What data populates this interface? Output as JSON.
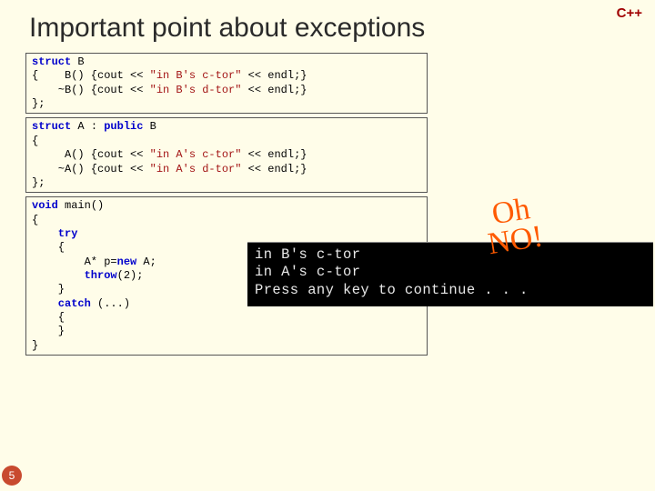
{
  "badge": "C++",
  "title": "Important point about exceptions",
  "code": {
    "b1_l1a": "struct",
    "b1_l1b": " B",
    "b1_l2a": "{    B() {cout << ",
    "b1_l2b": "\"in B's c-tor\"",
    "b1_l2c": " << endl;}",
    "b1_l3a": "    ~B() {cout << ",
    "b1_l3b": "\"in B's d-tor\"",
    "b1_l3c": " << endl;}",
    "b1_l4": "};",
    "b2_l1a": "struct",
    "b2_l1b": " A : ",
    "b2_l1c": "public",
    "b2_l1d": " B",
    "b2_l2": "{",
    "b2_l3a": "     A() {cout << ",
    "b2_l3b": "\"in A's c-tor\"",
    "b2_l3c": " << endl;}",
    "b2_l4a": "    ~A() {cout << ",
    "b2_l4b": "\"in A's d-tor\"",
    "b2_l4c": " << endl;}",
    "b2_l5": "};",
    "b3_l1a": "void",
    "b3_l1b": " main()",
    "b3_l2": "{",
    "b3_l3a": "    try",
    "b3_l4": "    {",
    "b3_l5a": "        A* p=",
    "b3_l5b": "new",
    "b3_l5c": " A;",
    "b3_l6a": "        throw",
    "b3_l6b": "(2);",
    "b3_l7": "    }",
    "b3_l8a": "    catch",
    "b3_l8b": " (...)",
    "b3_l9": "    {",
    "b3_l10": "    }",
    "b3_l11": "}"
  },
  "console": {
    "line1": "in B's c-tor",
    "line2": "in A's c-tor",
    "line3": "Press any key to continue . . ."
  },
  "ohno": {
    "line1": "Oh",
    "line2": "NO!"
  },
  "pagenum": "5"
}
